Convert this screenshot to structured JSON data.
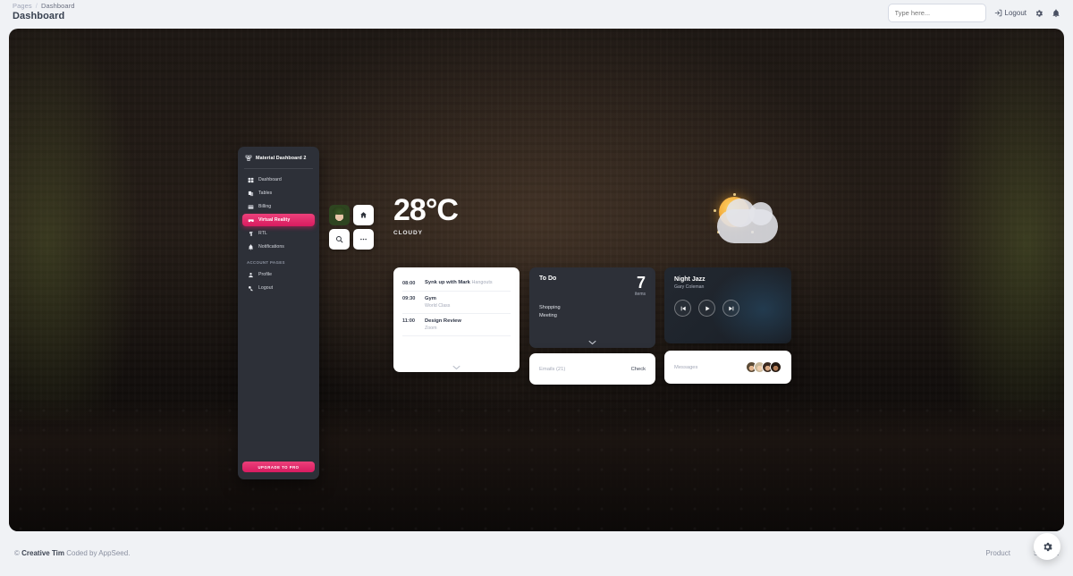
{
  "header": {
    "breadcrumb_root": "Pages",
    "breadcrumb_sep": "/",
    "breadcrumb_current": "Dashboard",
    "page_title": "Dashboard",
    "search_placeholder": "Type here...",
    "logout_label": "Logout"
  },
  "vr_sidebar": {
    "brand": "Material Dashboard 2",
    "items": [
      {
        "label": "Dashboard",
        "icon": "dashboard-icon",
        "active": false
      },
      {
        "label": "Tables",
        "icon": "tables-icon",
        "active": false
      },
      {
        "label": "Billing",
        "icon": "billing-icon",
        "active": false
      },
      {
        "label": "Virtual Reality",
        "icon": "vr-icon",
        "active": true
      },
      {
        "label": "RTL",
        "icon": "rtl-icon",
        "active": false
      },
      {
        "label": "Notifications",
        "icon": "bell-icon",
        "active": false
      }
    ],
    "section_label": "ACCOUNT PAGES",
    "account_items": [
      {
        "label": "Profile",
        "icon": "person-icon"
      },
      {
        "label": "Logout",
        "icon": "key-icon"
      }
    ],
    "upgrade_label": "UPGRADE TO PRO",
    "accent_color": "#d81b60"
  },
  "weather": {
    "temperature": "28°C",
    "condition": "CLOUDY",
    "icon": "sun-behind-cloud-icon"
  },
  "quick_controls": {
    "avatar": "user-avatar",
    "buttons": [
      "home-icon",
      "search-icon",
      "more-icon"
    ]
  },
  "schedule": {
    "events": [
      {
        "time": "08:00",
        "title": "Synk up with Mark",
        "meta": "Hangouts",
        "sub": ""
      },
      {
        "time": "09:30",
        "title": "Gym",
        "meta": "",
        "sub": "World Class"
      },
      {
        "time": "11:00",
        "title": "Design Review",
        "meta": "",
        "sub": "Zoom"
      }
    ],
    "expand_icon": "chevron-down-icon"
  },
  "todo": {
    "title": "To Do",
    "count": "7",
    "count_label": "items",
    "items": [
      "Shopping",
      "Meeting"
    ],
    "expand_icon": "chevron-down-icon"
  },
  "music": {
    "title": "Night Jazz",
    "artist": "Gary Coleman",
    "controls": [
      "previous-icon",
      "play-icon",
      "next-icon"
    ]
  },
  "emails": {
    "label": "Emails (21)",
    "action": "Check"
  },
  "messages": {
    "label": "Messages",
    "avatar_count": 4
  },
  "footer": {
    "copyright_symbol": "©",
    "brand": "Creative Tim",
    "credit": "Coded by AppSeed.",
    "links": [
      "Product",
      "Support"
    ],
    "settings_icon": "gear-icon"
  }
}
